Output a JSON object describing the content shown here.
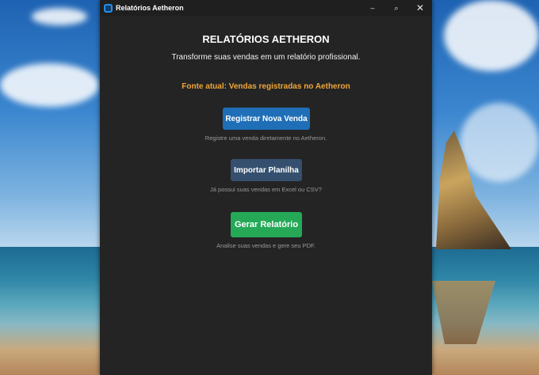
{
  "window": {
    "title": "Relatórios Aetheron",
    "controls": {
      "minimize": "–",
      "maximize": "⌕",
      "close": "✕"
    }
  },
  "main": {
    "heading": "RELATÓRIOS AETHERON",
    "subtitle": "Transforme suas vendas em um relatório profissional.",
    "current_source": "Fonte atual: Vendas registradas no Aetheron",
    "actions": [
      {
        "label": "Registrar Nova Venda",
        "hint": "Registre uma venda diretamente no Aetheron.",
        "color": "#1f6fb8"
      },
      {
        "label": "Importar Planilha",
        "hint": "Já possui suas vendas em Excel ou CSV?",
        "color": "#35506f"
      },
      {
        "label": "Gerar Relatório",
        "hint": "Analise suas vendas e gere seu PDF.",
        "color": "#25a957"
      }
    ]
  },
  "colors": {
    "accent_orange": "#f0a63a",
    "window_bg": "#242424"
  }
}
